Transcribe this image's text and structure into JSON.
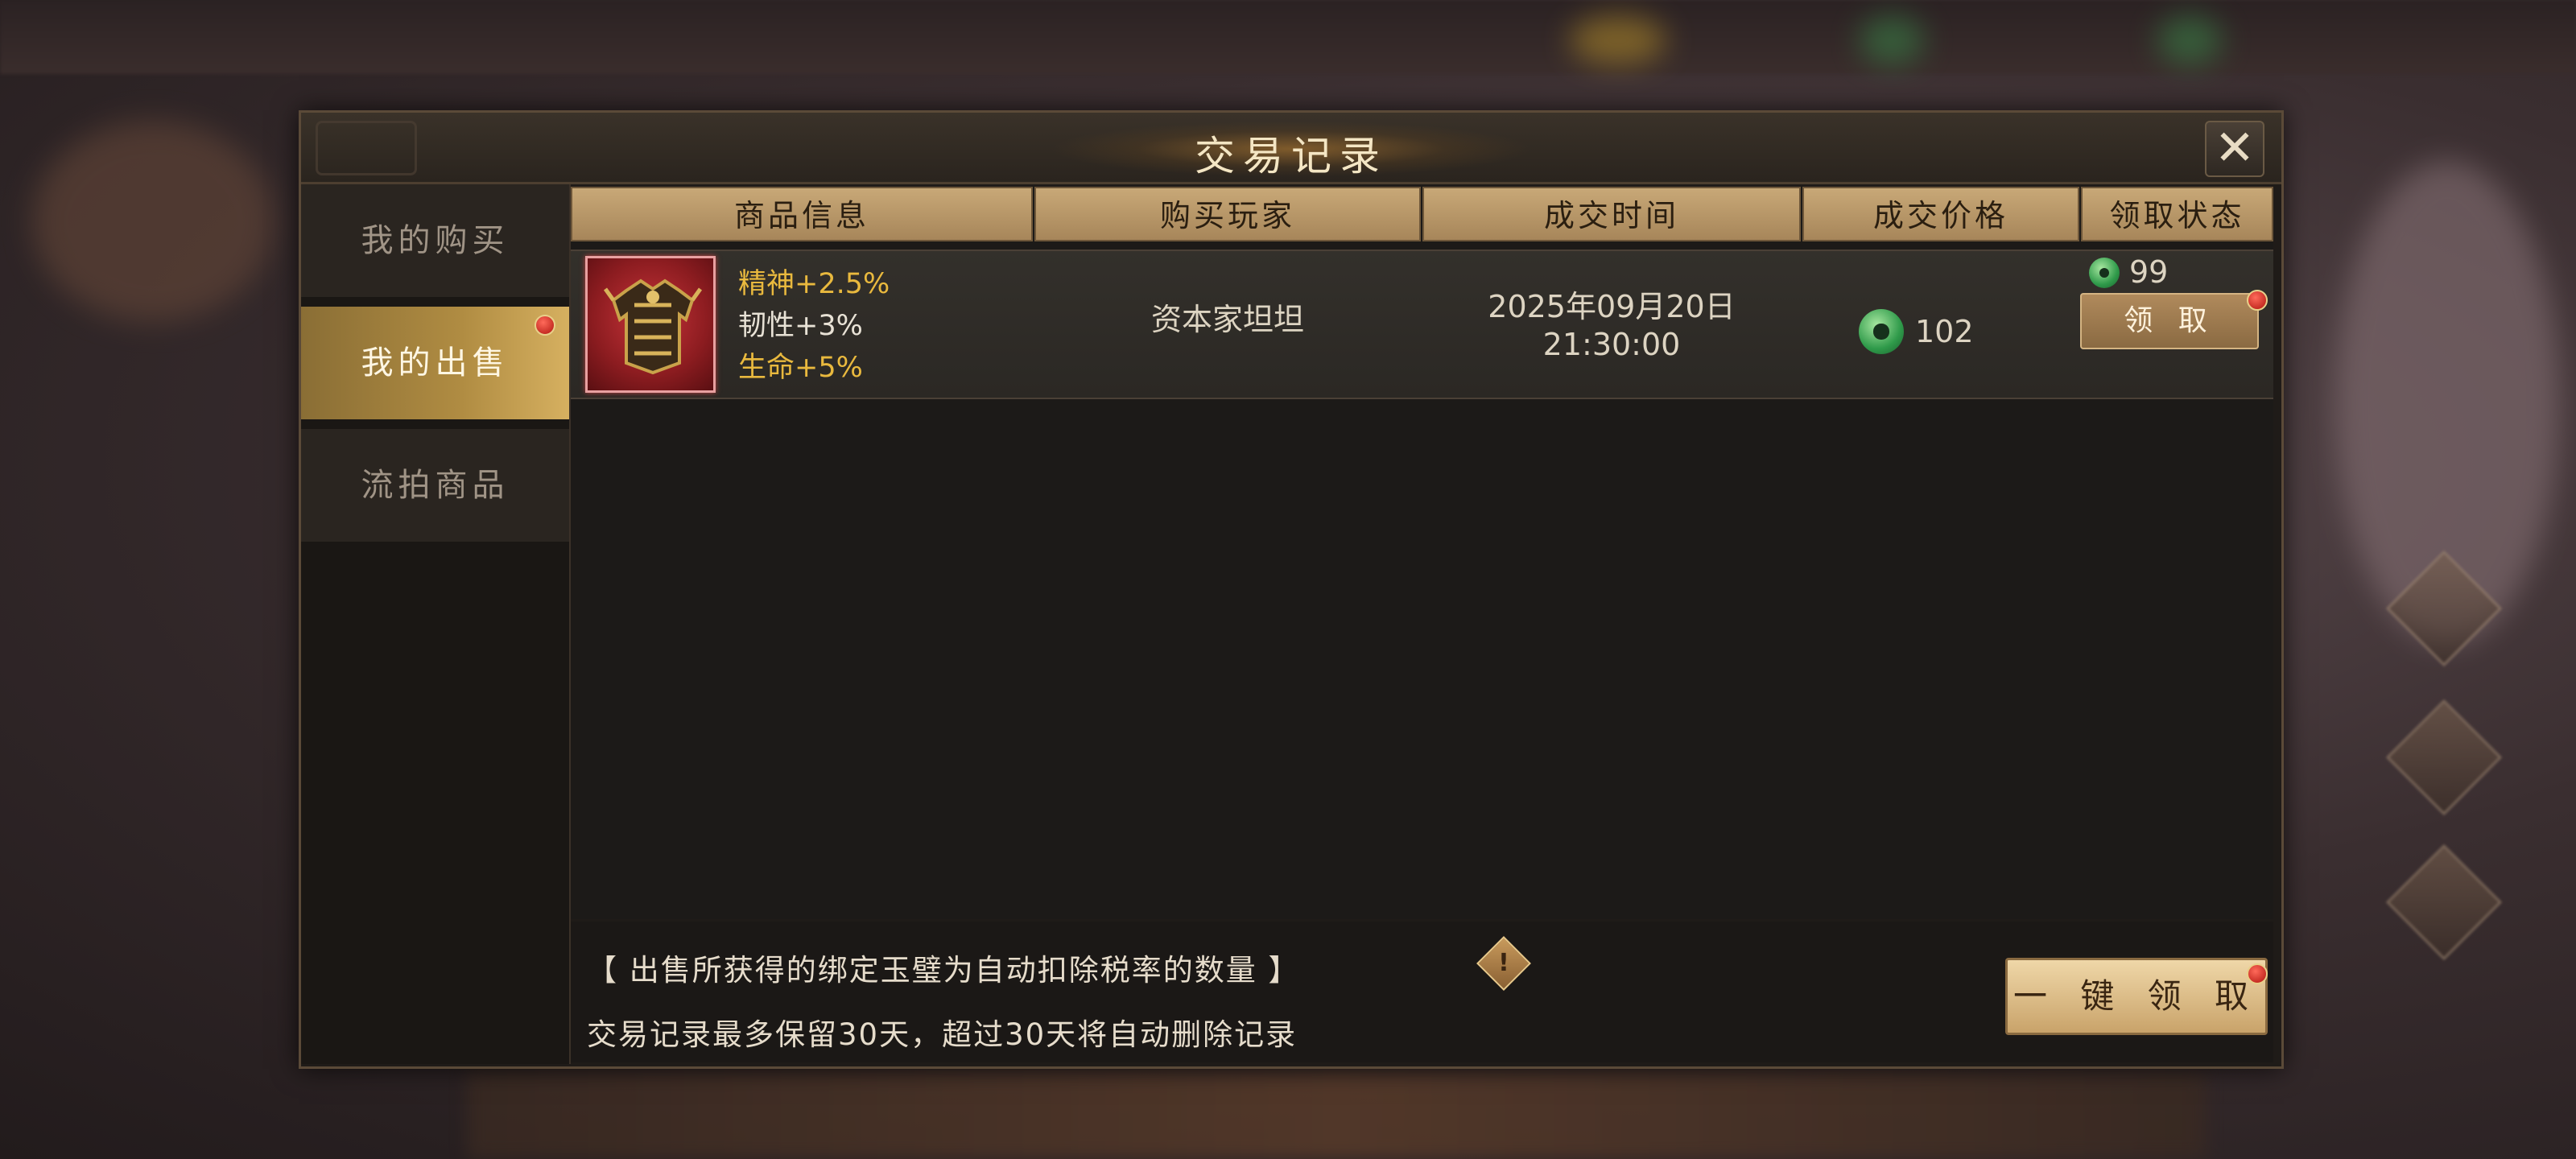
{
  "dialog": {
    "title": "交易记录",
    "close_icon": "close-icon"
  },
  "sidebar": {
    "tabs": [
      {
        "label": "我的购买",
        "active": false
      },
      {
        "label": "我的出售",
        "active": true,
        "badge": true
      },
      {
        "label": "流拍商品",
        "active": false
      }
    ]
  },
  "table": {
    "headers": [
      "商品信息",
      "购买玩家",
      "成交时间",
      "成交价格",
      "领取状态"
    ],
    "rows": [
      {
        "item_icon": "armor-icon",
        "stats": [
          {
            "text": "精神+2.5%",
            "color": "#e9b93e"
          },
          {
            "text": "韧性+3%",
            "color": "#e8e2d6"
          },
          {
            "text": "生命+5%",
            "color": "#e9b93e"
          }
        ],
        "buyer": "资本家坦坦",
        "date": "2025年09月20日",
        "time": "21:30:00",
        "price": "102",
        "claim_amount": "99",
        "claim_label": "领 取"
      }
    ]
  },
  "footer": {
    "note1": "【 出售所获得的绑定玉璧为自动扣除税率的数量 】",
    "note2": "交易记录最多保留30天，超过30天将自动删除记录",
    "warning_icon": "warning-icon",
    "claim_all_label": "一 键 领 取"
  },
  "colors": {
    "accent_gold": "#c8a877",
    "stat_gold": "#e9b93e",
    "badge_red": "#b0150f",
    "jade_green": "#2f9a4a"
  }
}
